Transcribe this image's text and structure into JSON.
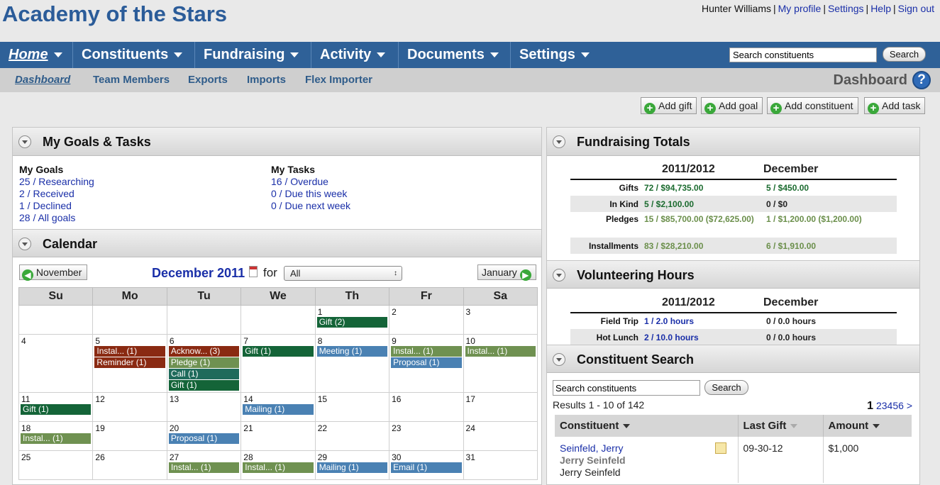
{
  "app": {
    "title": "Academy of the Stars"
  },
  "user": {
    "name": "Hunter Williams",
    "links": [
      "My profile",
      "Settings",
      "Help",
      "Sign out"
    ]
  },
  "nav": {
    "items": [
      "Home",
      "Constituents",
      "Fundraising",
      "Activity",
      "Documents",
      "Settings"
    ],
    "search_placeholder": "Search constituents",
    "search_button": "Search"
  },
  "subnav": {
    "items": [
      "Dashboard",
      "Team Members",
      "Exports",
      "Imports",
      "Flex Importer"
    ],
    "page_label": "Dashboard",
    "help": "?"
  },
  "actions": [
    "Add gift",
    "Add goal",
    "Add constituent",
    "Add task"
  ],
  "goals_panel": {
    "title": "My Goals & Tasks",
    "goals_heading": "My Goals",
    "goals": [
      "25 / Researching",
      "2 / Received",
      "1 / Declined",
      "28 / All goals"
    ],
    "tasks_heading": "My Tasks",
    "tasks": [
      "16 / Overdue",
      "0 / Due this week",
      "0 / Due next week"
    ]
  },
  "calendar": {
    "title": "Calendar",
    "prev": "November",
    "next": "January",
    "month": "December 2011",
    "for_label": "for",
    "filter_value": "All",
    "weekdays": [
      "Su",
      "Mo",
      "Tu",
      "We",
      "Th",
      "Fr",
      "Sa"
    ],
    "weeks": [
      [
        {
          "d": ""
        },
        {
          "d": ""
        },
        {
          "d": ""
        },
        {
          "d": ""
        },
        {
          "d": "1",
          "ev": [
            {
              "t": "Gift (2)",
              "c": "gift"
            }
          ]
        },
        {
          "d": "2"
        },
        {
          "d": "3"
        }
      ],
      [
        {
          "d": "4"
        },
        {
          "d": "5",
          "ev": [
            {
              "t": "Instal... (1)",
              "c": "acknow"
            },
            {
              "t": "Reminder (1)",
              "c": "reminder"
            }
          ]
        },
        {
          "d": "6",
          "ev": [
            {
              "t": "Acknow... (3)",
              "c": "acknow"
            },
            {
              "t": "Pledge (1)",
              "c": "pledge"
            },
            {
              "t": "Call (1)",
              "c": "call"
            },
            {
              "t": "Gift (1)",
              "c": "gift"
            }
          ]
        },
        {
          "d": "7",
          "ev": [
            {
              "t": "Gift (1)",
              "c": "gift"
            }
          ]
        },
        {
          "d": "8",
          "ev": [
            {
              "t": "Meeting (1)",
              "c": "meeting"
            }
          ]
        },
        {
          "d": "9",
          "ev": [
            {
              "t": "Instal... (1)",
              "c": "instal"
            },
            {
              "t": "Proposal (1)",
              "c": "proposal"
            }
          ]
        },
        {
          "d": "10",
          "ev": [
            {
              "t": "Instal... (1)",
              "c": "instal"
            }
          ]
        }
      ],
      [
        {
          "d": "11",
          "ev": [
            {
              "t": "Gift (1)",
              "c": "gift"
            }
          ]
        },
        {
          "d": "12"
        },
        {
          "d": "13"
        },
        {
          "d": "14",
          "ev": [
            {
              "t": "Mailing (1)",
              "c": "mailing"
            }
          ]
        },
        {
          "d": "15"
        },
        {
          "d": "16"
        },
        {
          "d": "17"
        }
      ],
      [
        {
          "d": "18",
          "ev": [
            {
              "t": "Instal... (1)",
              "c": "instal"
            }
          ]
        },
        {
          "d": "19"
        },
        {
          "d": "20",
          "ev": [
            {
              "t": "Proposal (1)",
              "c": "proposal"
            }
          ]
        },
        {
          "d": "21"
        },
        {
          "d": "22"
        },
        {
          "d": "23"
        },
        {
          "d": "24"
        }
      ],
      [
        {
          "d": "25"
        },
        {
          "d": "26"
        },
        {
          "d": "27",
          "ev": [
            {
              "t": "Instal... (1)",
              "c": "instal"
            }
          ]
        },
        {
          "d": "28",
          "ev": [
            {
              "t": "Instal... (1)",
              "c": "instal"
            }
          ]
        },
        {
          "d": "29",
          "ev": [
            {
              "t": "Mailing (1)",
              "c": "mailing"
            }
          ]
        },
        {
          "d": "30",
          "ev": [
            {
              "t": "Email (1)",
              "c": "email"
            }
          ]
        },
        {
          "d": "31"
        }
      ]
    ]
  },
  "fundraising": {
    "title": "Fundraising Totals",
    "col1": "2011/2012",
    "col2": "December",
    "rows": [
      {
        "label": "Gifts",
        "v1": "72 / $94,735.00",
        "v2": "5 / $450.00"
      },
      {
        "label": "In Kind",
        "v1": "5 / $2,100.00",
        "v2": "0 / $0"
      },
      {
        "label": "Pledges",
        "v1": "15 / $85,700.00 ($72,625.00)",
        "v2": "1 / $1,200.00 ($1,200.00)"
      },
      {
        "label": "Installments",
        "v1": "83 / $28,210.00",
        "v2": "6 / $1,910.00"
      }
    ]
  },
  "volunteering": {
    "title": "Volunteering Hours",
    "col1": "2011/2012",
    "col2": "December",
    "rows": [
      {
        "label": "Field Trip",
        "v1": "1 / 2.0 hours",
        "v2": "0 / 0.0 hours"
      },
      {
        "label": "Hot Lunch",
        "v1": "2 / 10.0 hours",
        "v2": "0 / 0.0 hours"
      }
    ]
  },
  "constituent_search": {
    "title": "Constituent Search",
    "placeholder": "Search constituents",
    "button": "Search",
    "results_text": "Results 1 - 10 of 142",
    "pages": [
      "1",
      "2",
      "3",
      "4",
      "5",
      "6",
      ">"
    ],
    "columns": [
      "Constituent",
      "Last Gift",
      "Amount"
    ],
    "rows": [
      {
        "link": "Seinfeld, Jerry",
        "line2": "Jerry Seinfeld",
        "line3": "Jerry Seinfeld",
        "last_gift": "09-30-12",
        "amount": "$1,000"
      }
    ]
  }
}
